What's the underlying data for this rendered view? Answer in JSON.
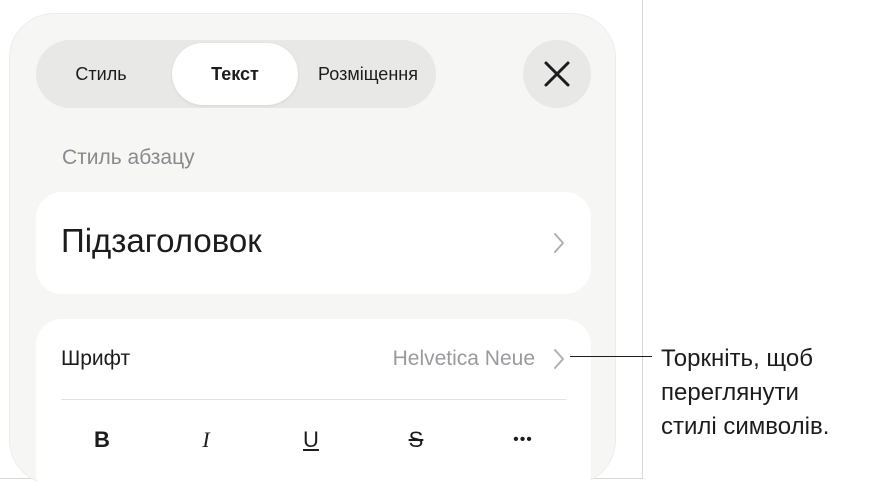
{
  "tabs": {
    "style": "Стиль",
    "text": "Текст",
    "layout": "Розміщення"
  },
  "close_icon": "close-icon",
  "paragraph_style": {
    "label": "Стиль абзацу",
    "value": "Підзаголовок"
  },
  "font": {
    "label": "Шрифт",
    "value": "Helvetica Neue"
  },
  "format_buttons": {
    "bold": "B",
    "italic": "I",
    "underline": "U",
    "strikethrough": "S",
    "more": "•••"
  },
  "callout": {
    "line1": "Торкніть, щоб",
    "line2": "переглянути",
    "line3": "стилі символів."
  }
}
